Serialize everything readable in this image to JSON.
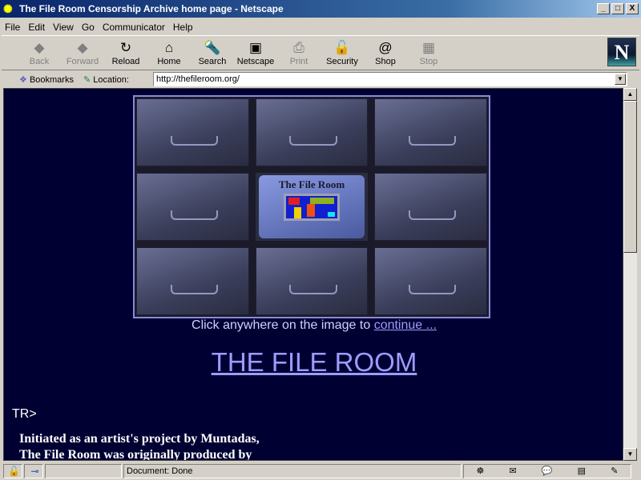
{
  "window": {
    "title": "The File Room Censorship Archive home page - Netscape",
    "minimize": "_",
    "maximize": "□",
    "close": "X"
  },
  "menu": [
    "File",
    "Edit",
    "View",
    "Go",
    "Communicator",
    "Help"
  ],
  "toolbar": [
    {
      "label": "Back",
      "icon": "back-arrow-icon",
      "glyph": "◆",
      "enabled": false
    },
    {
      "label": "Forward",
      "icon": "forward-arrow-icon",
      "glyph": "◆",
      "enabled": false
    },
    {
      "label": "Reload",
      "icon": "reload-icon",
      "glyph": "↻",
      "enabled": true
    },
    {
      "label": "Home",
      "icon": "home-icon",
      "glyph": "⌂",
      "enabled": true
    },
    {
      "label": "Search",
      "icon": "search-icon",
      "glyph": "🔦",
      "enabled": true
    },
    {
      "label": "Netscape",
      "icon": "my-netscape-icon",
      "glyph": "▣",
      "enabled": true
    },
    {
      "label": "Print",
      "icon": "print-icon",
      "glyph": "⎙",
      "enabled": false
    },
    {
      "label": "Security",
      "icon": "lock-icon",
      "glyph": "🔓",
      "enabled": true
    },
    {
      "label": "Shop",
      "icon": "shop-bag-icon",
      "glyph": "@",
      "enabled": true
    },
    {
      "label": "Stop",
      "icon": "stop-icon",
      "glyph": "▦",
      "enabled": false
    }
  ],
  "logo": "N",
  "location": {
    "bookmarks": "Bookmarks",
    "label": "Location:",
    "url": "http://thefileroom.org/"
  },
  "page": {
    "image_title": "The File Room",
    "caption": "Click anywhere on the image to ",
    "caption_link": "continue ...",
    "heading": "THE FILE ROOM",
    "stray": "TR>",
    "para1": "Initiated as an artist's project by Muntadas,",
    "para2": "The File Room was originally produced by"
  },
  "status": {
    "text": "Document: Done"
  },
  "colors": {
    "background": "#000033",
    "link": "#9c9cff"
  }
}
